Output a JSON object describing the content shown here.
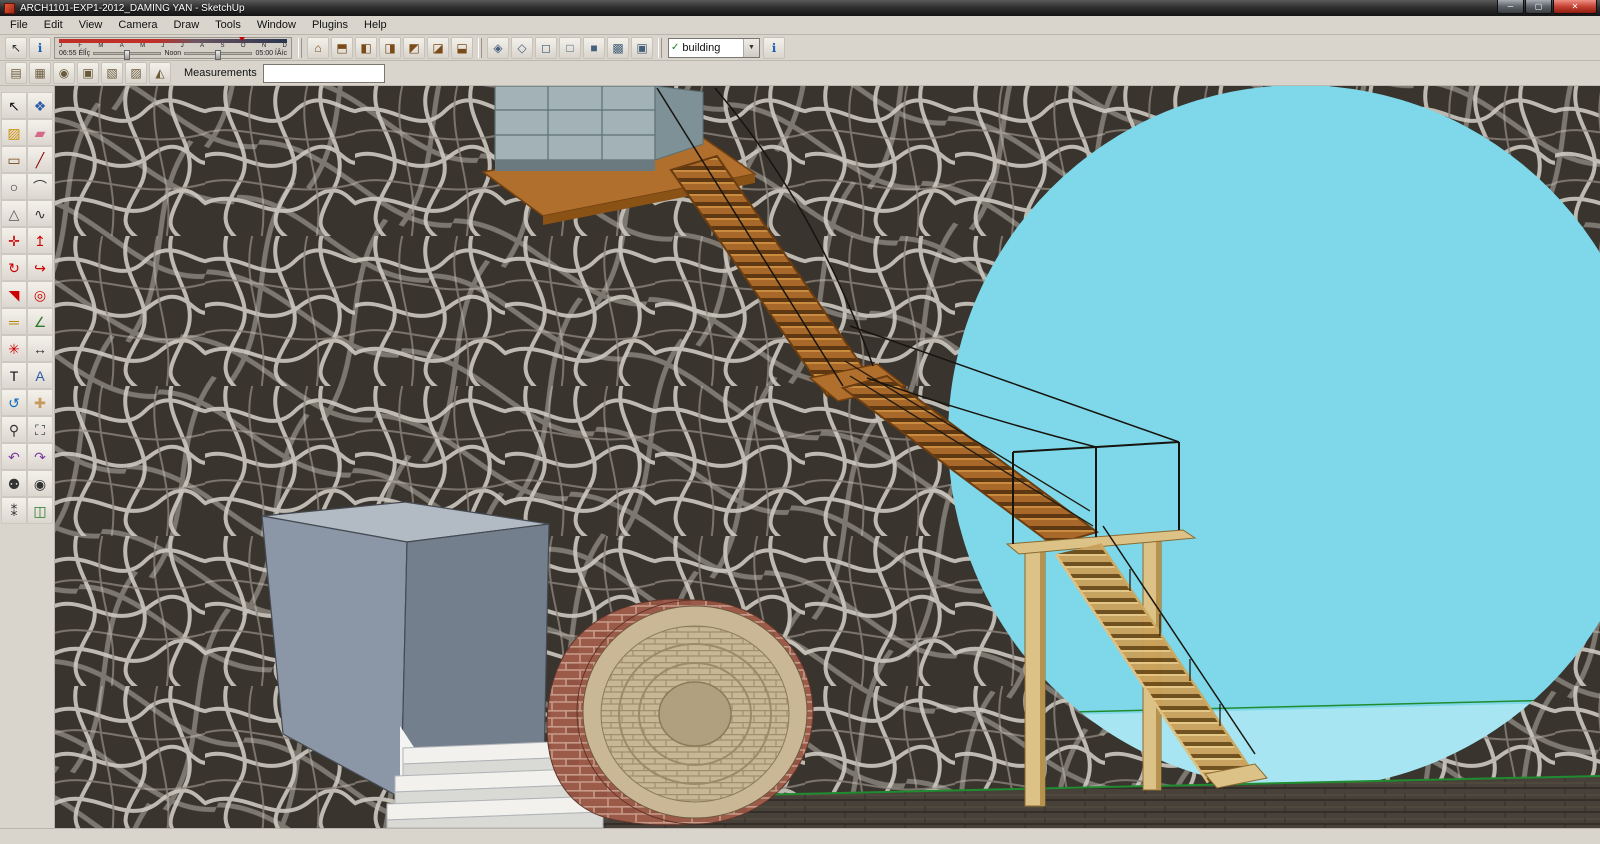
{
  "window": {
    "title": "ARCH1101-EXP1-2012_DAMING YAN - SketchUp",
    "controls": {
      "minimize": "─",
      "maximize": "▢",
      "close": "✕"
    }
  },
  "menus": [
    {
      "label": "File"
    },
    {
      "label": "Edit"
    },
    {
      "label": "View"
    },
    {
      "label": "Camera"
    },
    {
      "label": "Draw"
    },
    {
      "label": "Tools"
    },
    {
      "label": "Window"
    },
    {
      "label": "Plugins"
    },
    {
      "label": "Help"
    }
  ],
  "toolbar1": {
    "pointer_button_glyph": "↖",
    "instructor_button_glyph": "ℹ",
    "shadow": {
      "months": [
        "J",
        "F",
        "M",
        "A",
        "M",
        "J",
        "J",
        "A",
        "S",
        "O",
        "N",
        "D"
      ],
      "time_start": "06:55 ÉlÎç",
      "noon_label": "Noon",
      "time_end": "05:00 ÍÂíc"
    },
    "views": [
      {
        "name": "view-iso-button",
        "glyph": "⌂"
      },
      {
        "name": "view-top-button",
        "glyph": "⬒"
      },
      {
        "name": "view-front-button",
        "glyph": "◧"
      },
      {
        "name": "view-back-button",
        "glyph": "◨"
      },
      {
        "name": "view-left-button",
        "glyph": "◩"
      },
      {
        "name": "view-right-button",
        "glyph": "◪"
      },
      {
        "name": "view-bottom-button",
        "glyph": "⬓"
      }
    ],
    "styles": [
      {
        "name": "style-xray-button",
        "glyph": "◈"
      },
      {
        "name": "style-back-edges-button",
        "glyph": "◇"
      },
      {
        "name": "style-wireframe-button",
        "glyph": "◻"
      },
      {
        "name": "style-hidden-line-button",
        "glyph": "□"
      },
      {
        "name": "style-shaded-button",
        "glyph": "■"
      },
      {
        "name": "style-textured-button",
        "glyph": "▩"
      },
      {
        "name": "style-monochrome-button",
        "glyph": "▣"
      }
    ],
    "layer": {
      "check": "✓",
      "value": "building",
      "arrow": "▼"
    },
    "info_glyph": "ℹ"
  },
  "toolbar2": {
    "sandbox": [
      {
        "name": "sandbox-from-contours-button",
        "glyph": "▤"
      },
      {
        "name": "sandbox-from-scratch-button",
        "glyph": "▦"
      },
      {
        "name": "smoove-button",
        "glyph": "◉"
      },
      {
        "name": "stamp-button",
        "glyph": "▣"
      },
      {
        "name": "drape-button",
        "glyph": "▧"
      },
      {
        "name": "add-detail-button",
        "glyph": "▨"
      },
      {
        "name": "flip-edge-button",
        "glyph": "◭"
      }
    ],
    "measurements_label": "Measurements",
    "measurements_value": ""
  },
  "tools": [
    {
      "name": "select-tool",
      "glyph": "↖",
      "css": "color:#111"
    },
    {
      "name": "make-component-tool",
      "glyph": "❖",
      "css": "color:#2a5caa"
    },
    {
      "name": "paint-bucket-tool",
      "glyph": "▨",
      "css": "color:#c8900a"
    },
    {
      "name": "eraser-tool",
      "glyph": "▰",
      "css": "color:#d4698a"
    },
    {
      "name": "rectangle-tool",
      "glyph": "▭",
      "css": "color:#7a4a18"
    },
    {
      "name": "line-tool",
      "glyph": "╱",
      "css": "color:#8a0a0a"
    },
    {
      "name": "circle-tool",
      "glyph": "○",
      "css": "color:#333"
    },
    {
      "name": "arc-tool",
      "glyph": "⌒",
      "css": "color:#333"
    },
    {
      "name": "polygon-tool",
      "glyph": "△",
      "css": "color:#555"
    },
    {
      "name": "freehand-tool",
      "glyph": "∿",
      "css": "color:#333"
    },
    {
      "name": "move-tool",
      "glyph": "✛",
      "css": "color:#c00"
    },
    {
      "name": "push-pull-tool",
      "glyph": "↥",
      "css": "color:#c00"
    },
    {
      "name": "rotate-tool",
      "glyph": "↻",
      "css": "color:#c00"
    },
    {
      "name": "follow-me-tool",
      "glyph": "↪",
      "css": "color:#c00"
    },
    {
      "name": "scale-tool",
      "glyph": "◥",
      "css": "color:#c00"
    },
    {
      "name": "offset-tool",
      "glyph": "◎",
      "css": "color:#c00"
    },
    {
      "name": "tape-measure-tool",
      "glyph": "═",
      "css": "color:#b8860b"
    },
    {
      "name": "protractor-tool",
      "glyph": "∠",
      "css": "color:#2a7a2a"
    },
    {
      "name": "axes-tool",
      "glyph": "✳",
      "css": "color:#c00"
    },
    {
      "name": "dimension-tool",
      "glyph": "↔",
      "css": "color:#333"
    },
    {
      "name": "text-tool",
      "glyph": "T",
      "css": "color:#111"
    },
    {
      "name": "3d-text-tool",
      "glyph": "A",
      "css": "color:#2a5caa"
    },
    {
      "name": "orbit-tool",
      "glyph": "↺",
      "css": "color:#0a6abf"
    },
    {
      "name": "pan-tool",
      "glyph": "✚",
      "css": "color:#c89a5a"
    },
    {
      "name": "zoom-tool",
      "glyph": "⚲",
      "css": "color:#333"
    },
    {
      "name": "zoom-extents-tool",
      "glyph": "⛶",
      "css": "color:#333"
    },
    {
      "name": "previous-view-tool",
      "glyph": "↶",
      "css": "color:#7a3aa0"
    },
    {
      "name": "next-view-tool",
      "glyph": "↷",
      "css": "color:#7a3aa0"
    },
    {
      "name": "position-camera-tool",
      "glyph": "⚉",
      "css": "color:#333"
    },
    {
      "name": "look-around-tool",
      "glyph": "◉",
      "css": "color:#333"
    },
    {
      "name": "walk-tool",
      "glyph": "⁑",
      "css": "color:#333"
    },
    {
      "name": "section-plane-tool",
      "glyph": "◫",
      "css": "color:#2a7a2a"
    }
  ],
  "statusbar": {
    "text": ""
  },
  "scene": {
    "sky": "#7ed8e9",
    "water": "#abe7f2",
    "wall_bg": "#39342e",
    "wall_stroke": "#d6d1c8",
    "wood": "#a8682a",
    "light_wood": "#ddc287",
    "brick": "#9c5a48",
    "box_gray": "#8b97a6",
    "axis_green": "#1f8c2f",
    "floor": "#47413a"
  }
}
